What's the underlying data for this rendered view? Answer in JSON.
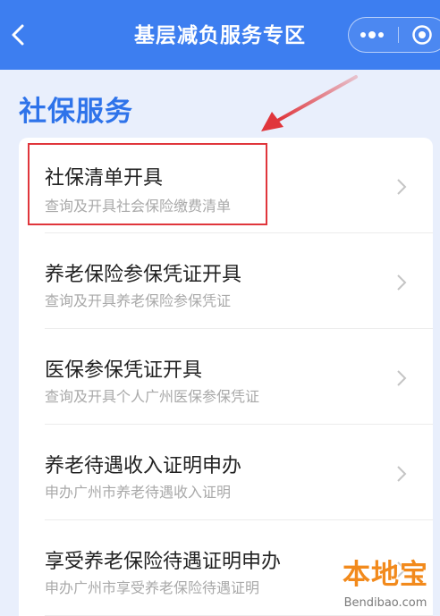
{
  "header": {
    "title": "基层减负服务专区",
    "back_icon": "chevron-left-icon",
    "more_icon": "more-dots-icon",
    "close_icon": "target-close-icon",
    "bg_color": "#3d7ef0"
  },
  "section": {
    "title": "社保服务",
    "title_color": "#2e73ea"
  },
  "items": [
    {
      "title": "社保清单开具",
      "subtitle": "查询及开具社会保险缴费清单",
      "highlighted": true
    },
    {
      "title": "养老保险参保凭证开具",
      "subtitle": "查询及开具养老保险参保凭证"
    },
    {
      "title": "医保参保凭证开具",
      "subtitle": "查询及开具个人广州医保参保凭证"
    },
    {
      "title": "养老待遇收入证明申办",
      "subtitle": "申办广州市养老待遇收入证明"
    },
    {
      "title": "享受养老保险待遇证明申办",
      "subtitle": "申办广州市享受养老保险待遇证明"
    }
  ],
  "annotation": {
    "highlight_color": "#e0363c"
  },
  "watermark": {
    "main": "本地宝",
    "sub": "Bendibao.com"
  }
}
